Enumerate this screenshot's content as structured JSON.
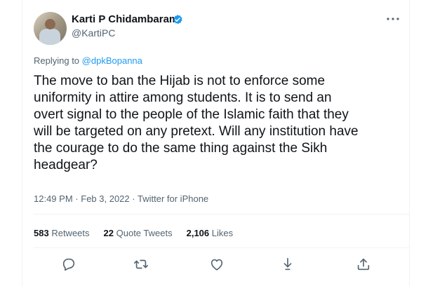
{
  "author": {
    "name": "Karti P Chidambaram",
    "handle": "@KartiPC"
  },
  "reply": {
    "prefix": "Replying to",
    "mention": "@dpkBopanna"
  },
  "tweet": {
    "lines": [
      "The move to ban the Hijab is not to enforce some",
      "uniformity in attire among students. It is to send an",
      "overt signal to the people of the Islamic faith that they",
      "will be targeted on any pretext. Will any institution have",
      "the courage to do the same thing against the Sikh",
      "headgear?"
    ]
  },
  "meta": {
    "time": "12:49 PM",
    "separator": "·",
    "date": "Feb 3, 2022",
    "source": "Twitter for iPhone"
  },
  "stats": {
    "retweets_count": "583",
    "retweets_label": "Retweets",
    "quote_count": "22",
    "quote_label": "Quote Tweets",
    "likes_count": "2,106",
    "likes_label": "Likes"
  },
  "icons": [
    "reply-icon",
    "retweet-icon",
    "like-icon",
    "bookmark-icon",
    "share-icon",
    "more-icon",
    "verified-badge-icon"
  ],
  "colors": {
    "accent": "#1d9bf0",
    "text_primary": "#0f1419",
    "text_secondary": "#536471",
    "divider": "#eff3f4"
  }
}
